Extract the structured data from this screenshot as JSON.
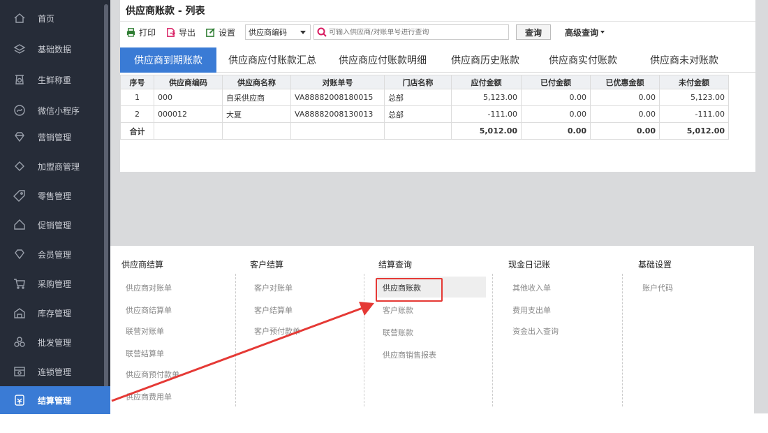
{
  "sidebar": {
    "items": [
      {
        "label": "首页",
        "icon": "home-icon"
      },
      {
        "label": "基础数据",
        "icon": "layers-icon"
      },
      {
        "label": "生鲜称重",
        "icon": "scale-icon"
      },
      {
        "label": "微信小程序",
        "icon": "mini-program-icon"
      },
      {
        "label": "营销管理",
        "icon": "diamond-icon"
      },
      {
        "label": "加盟商管理",
        "icon": "tag-icon"
      },
      {
        "label": "零售管理",
        "icon": "price-tag-icon"
      },
      {
        "label": "促销管理",
        "icon": "promo-icon"
      },
      {
        "label": "会员管理",
        "icon": "member-icon"
      },
      {
        "label": "采购管理",
        "icon": "cart-icon"
      },
      {
        "label": "库存管理",
        "icon": "warehouse-icon"
      },
      {
        "label": "批发管理",
        "icon": "wholesale-icon"
      },
      {
        "label": "连锁管理",
        "icon": "chain-icon"
      },
      {
        "label": "结算管理",
        "icon": "settlement-icon"
      }
    ],
    "active_index": 13
  },
  "page": {
    "title": "供应商账款 - 列表"
  },
  "toolbar": {
    "print_label": "打印",
    "export_label": "导出",
    "settings_label": "设置",
    "select_value": "供应商编码",
    "search_placeholder": "可输入供应商/对账单号进行查询",
    "query_label": "查询",
    "advanced_label": "高级查询"
  },
  "tabs": [
    {
      "label": "供应商到期账款"
    },
    {
      "label": "供应商应付账款汇总"
    },
    {
      "label": "供应商应付账款明细"
    },
    {
      "label": "供应商历史账款"
    },
    {
      "label": "供应商实付账款"
    },
    {
      "label": "供应商未对账款"
    }
  ],
  "table": {
    "headers": [
      "序号",
      "供应商编码",
      "供应商名称",
      "对账单号",
      "门店名称",
      "应付金额",
      "已付金额",
      "已优惠金额",
      "未付金额"
    ],
    "rows": [
      [
        "1",
        "000",
        "自采供应商",
        "VA88882008180015",
        "总部",
        "5,123.00",
        "0.00",
        "0.00",
        "5,123.00"
      ],
      [
        "2",
        "000012",
        "大夏",
        "VA88882008130013",
        "总部",
        "-111.00",
        "0.00",
        "0.00",
        "-111.00"
      ]
    ],
    "summary": [
      "合计",
      "",
      "",
      "",
      "",
      "5,012.00",
      "0.00",
      "0.00",
      "5,012.00"
    ]
  },
  "menu": {
    "columns": [
      {
        "head": "供应商结算",
        "items": [
          "供应商对账单",
          "供应商结算单",
          "联营对账单",
          "联营结算单",
          "供应商预付款单",
          "供应商费用单"
        ]
      },
      {
        "head": "客户结算",
        "items": [
          "客户对账单",
          "客户结算单",
          "客户预付款单"
        ]
      },
      {
        "head": "结算查询",
        "items": [
          "供应商账款",
          "客户账款",
          "联营账款",
          "供应商销售报表"
        ]
      },
      {
        "head": "现金日记账",
        "items": [
          "其他收入单",
          "费用支出单",
          "资金出入查询"
        ]
      },
      {
        "head": "基础设置",
        "items": [
          "账户代码"
        ]
      }
    ]
  },
  "colors": {
    "sidebar_bg": "#262c38",
    "accent": "#3a7bd5",
    "highlight_red": "#e53935",
    "print_icon": "#2e7d32",
    "export_icon": "#d81b60",
    "settings_icon": "#2e7d32",
    "search_icon": "#d81b60"
  }
}
